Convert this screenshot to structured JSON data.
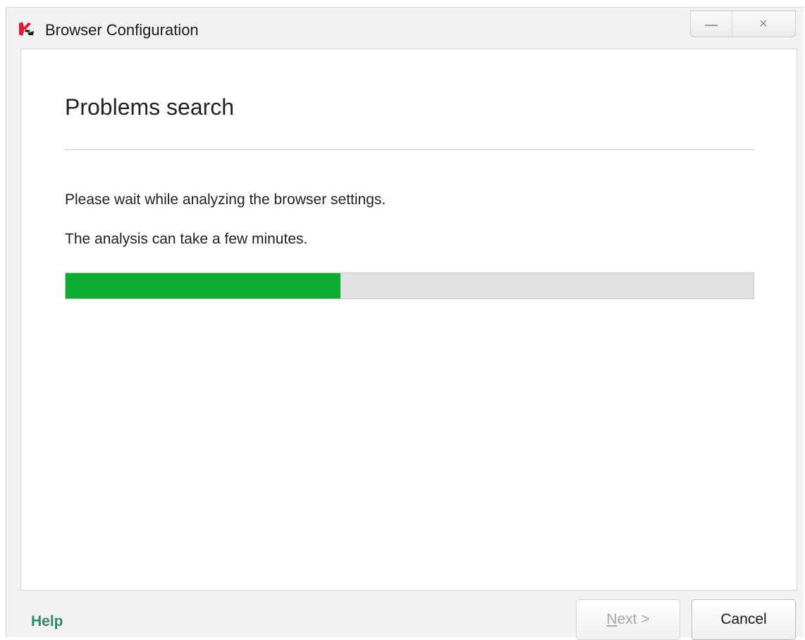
{
  "window": {
    "title": "Browser Configuration",
    "app_icon": "kaspersky-k-icon",
    "minimize_icon": "minimize-icon",
    "close_icon": "close-icon",
    "close_glyph": "×"
  },
  "main": {
    "heading": "Problems search",
    "message_1": "Please wait while analyzing the browser settings.",
    "message_2": "The analysis can take a few minutes.",
    "progress_fraction": 0.4,
    "progress_color": "#0fac34"
  },
  "footer": {
    "help_label": "Help",
    "next_label_first": "N",
    "next_label_rest": "ext >",
    "next_enabled": false,
    "cancel_label": "Cancel"
  },
  "colors": {
    "help_link": "#2f8a72",
    "brand_red": "#e8192c"
  }
}
